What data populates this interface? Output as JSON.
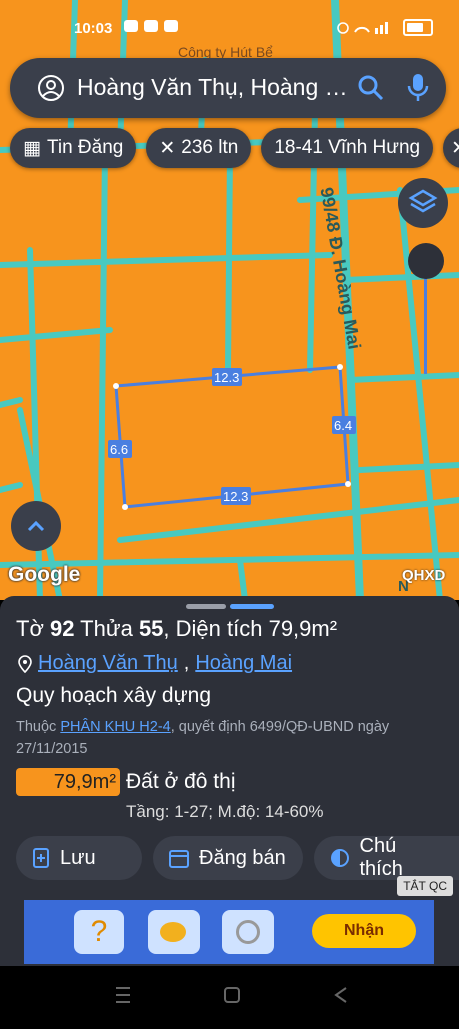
{
  "status": {
    "time": "10:03"
  },
  "search": {
    "text": "Hoàng Văn Thụ, Hoàng Mai"
  },
  "chips": [
    "Tin Đăng",
    "236 ltn",
    "18-41 Vĩnh Hưng"
  ],
  "map": {
    "label_top": "Công ty Hút Bể",
    "street": "99/48 Đ. Hoàng Mai",
    "dim_top": "12.3",
    "dim_right": "6.4",
    "dim_left": "6.6",
    "dim_bottom": "12.3",
    "google": "Google",
    "qhxd": "QHXD",
    "edge_letter": "N"
  },
  "sheet": {
    "title_prefix": "Tờ ",
    "sheet_no": "92",
    "title_mid": " Thửa ",
    "parcel_no": "55",
    "title_suffix": ", Diện tích 79,9m²",
    "street_link": "Hoàng Văn Thụ",
    "sep": ", ",
    "district_link": "Hoàng Mai",
    "section": "Quy hoạch xây dựng",
    "decision_prefix": "Thuộc ",
    "zone_link": "PHÂN KHU H2-4",
    "decision_suffix": ", quyết định 6499/QĐ-UBND ngày 27/11/2015",
    "area": "79,9m²",
    "land_use": "Đất ở đô thị",
    "floors": "Tầng: 1-27; M.độ: 14-60%"
  },
  "actions": {
    "save": "Lưu",
    "post": "Đăng bán",
    "legend": "Chú thích"
  },
  "ad": {
    "badge": "TẮT QC",
    "claim": "Nhận"
  },
  "colors": {
    "map": "#f7941d",
    "road": "#48c9c0",
    "panel": "#2d3039",
    "link": "#5aa2ff",
    "parcel": "#4a7fe0"
  }
}
